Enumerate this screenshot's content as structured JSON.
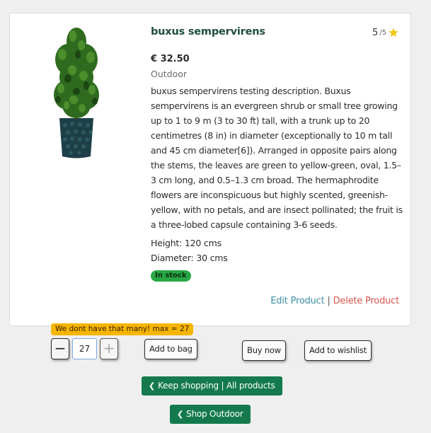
{
  "product": {
    "name": "buxus sempervirens",
    "rating": "5",
    "rating_max": "/5",
    "price": "€ 32.50",
    "category": "Outdoor",
    "description": "buxus sempervirens testing description. Buxus sempervirens is an evergreen shrub or small tree growing up to 1 to 9 m (3 to 30 ft) tall, with a trunk up to 20 centimetres (8 in) in diameter (exceptionally to 10 m tall and 45 cm diameter[6]). Arranged in opposite pairs along the stems, the leaves are green to yellow-green, oval, 1.5–3 cm long, and 0.5–1.3 cm broad. The hermaphrodite flowers are inconspicuous but highly scented, greenish-yellow, with no petals, and are insect pollinated; the fruit is a three-lobed capsule containing 3-6 seeds.",
    "height": "Height: 120 cms",
    "diameter": "Diameter: 30 cms",
    "stock": "In stock"
  },
  "admin": {
    "edit": "Edit Product",
    "separator": "|",
    "delete": "Delete Product"
  },
  "purchase": {
    "warning": "We dont have that many! max = 27",
    "decrement": "−",
    "quantity": "27",
    "increment": "+",
    "add_to_bag": "Add to bag",
    "buy_now": "Buy now",
    "add_to_wishlist": "Add to wishlist"
  },
  "nav": {
    "keep_shopping": "Keep shopping | All products",
    "shop_category": "Shop Outdoor"
  },
  "colors": {
    "accent_green": "#147a4e",
    "title_green": "#1f4d3c",
    "in_stock": "#28a745",
    "warning": "#f6b600",
    "edit_link": "#3d8fa6",
    "delete_link": "#d9534f",
    "star": "#f5c518"
  },
  "icons": {
    "rating": "star-icon",
    "back": "chevron-left-icon"
  }
}
